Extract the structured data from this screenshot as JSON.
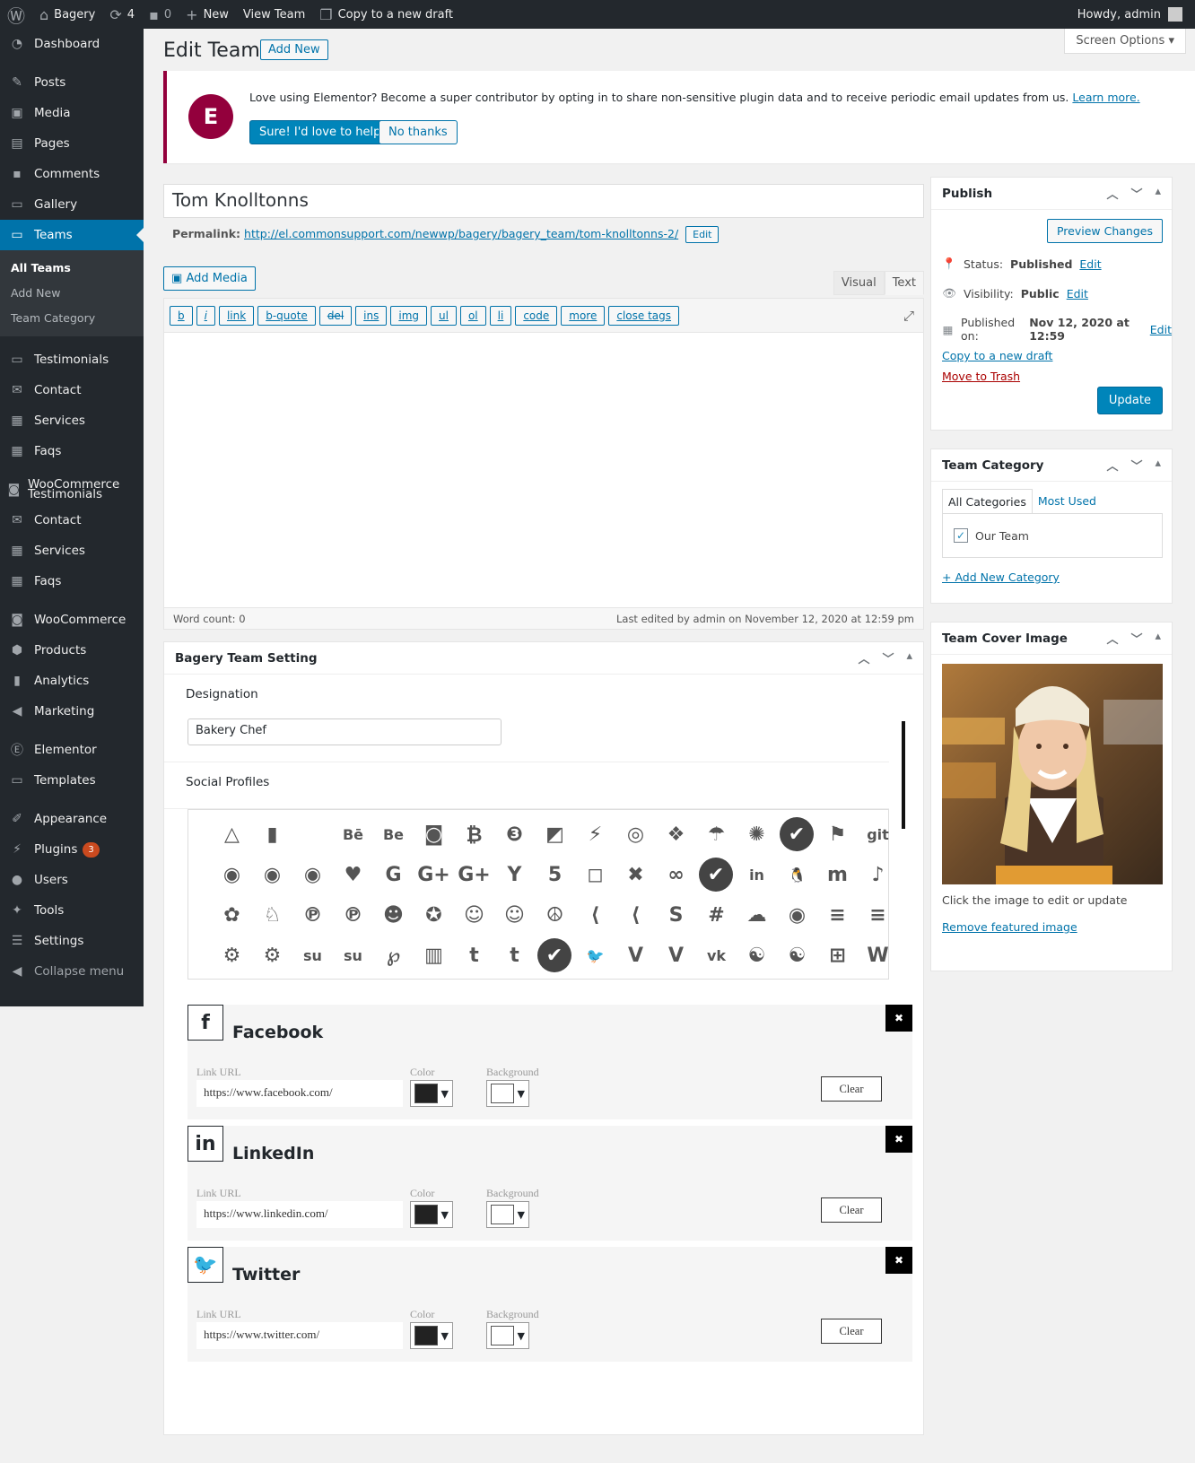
{
  "adminbar": {
    "site_name": "Bagery",
    "updates_count": "4",
    "comments_count": "0",
    "new_label": "New",
    "view_label": "View Team",
    "copy_label": "Copy to a new draft",
    "howdy": "Howdy, admin"
  },
  "sidebar": {
    "items": [
      {
        "label": "Dashboard",
        "icon": "dashboard-icon"
      },
      {
        "label": "Posts",
        "icon": "pin-icon"
      },
      {
        "label": "Media",
        "icon": "media-icon"
      },
      {
        "label": "Pages",
        "icon": "pages-icon"
      },
      {
        "label": "Comments",
        "icon": "comment-icon"
      },
      {
        "label": "Gallery",
        "icon": "folder-icon"
      },
      {
        "label": "Teams",
        "icon": "folder-icon"
      },
      {
        "label": "Testimonials",
        "icon": "folder-icon"
      },
      {
        "label": "Contact",
        "icon": "mail-icon"
      },
      {
        "label": "Services",
        "icon": "briefcase-icon"
      },
      {
        "label": "Faqs",
        "icon": "briefcase-icon"
      },
      {
        "label": "WooCommerce Testimonials",
        "icon": "woo-icon"
      },
      {
        "label": "Contact",
        "icon": "mail-icon"
      },
      {
        "label": "Services",
        "icon": "briefcase-icon"
      },
      {
        "label": "Faqs",
        "icon": "briefcase-icon"
      },
      {
        "label": "WooCommerce",
        "icon": "woo-icon"
      },
      {
        "label": "Products",
        "icon": "box-icon"
      },
      {
        "label": "Analytics",
        "icon": "chart-icon"
      },
      {
        "label": "Marketing",
        "icon": "megaphone-icon"
      },
      {
        "label": "Elementor",
        "icon": "elementor-icon"
      },
      {
        "label": "Templates",
        "icon": "folder-icon"
      },
      {
        "label": "Appearance",
        "icon": "brush-icon"
      },
      {
        "label": "Plugins",
        "icon": "plug-icon"
      },
      {
        "label": "Users",
        "icon": "user-icon"
      },
      {
        "label": "Tools",
        "icon": "wrench-icon"
      },
      {
        "label": "Settings",
        "icon": "settings-icon"
      },
      {
        "label": "Collapse menu",
        "icon": "collapse-icon"
      }
    ],
    "sub": [
      "All Teams",
      "Add New",
      "Team Category"
    ],
    "plugins_badge": "3"
  },
  "page": {
    "title": "Edit Team",
    "add_new": "Add New",
    "screen_options": "Screen Options"
  },
  "notice": {
    "text": "Love using Elementor? Become a super contributor by opting in to share non-sensitive plugin data and to receive periodic email updates from us.",
    "learn_more": "Learn more.",
    "yes_btn": "Sure! I'd love to help",
    "no_btn": "No thanks"
  },
  "post": {
    "title": "Tom Knolltonns",
    "permalink_label": "Permalink:",
    "permalink_url": "http://el.commonsupport.com/newwp/bagery/bagery_team/tom-knolltonns-2/",
    "edit_btn": "Edit",
    "add_media": "Add Media",
    "tab_visual": "Visual",
    "tab_text": "Text",
    "quicktags": [
      "b",
      "i",
      "link",
      "b-quote",
      "del",
      "ins",
      "img",
      "ul",
      "ol",
      "li",
      "code",
      "more",
      "close tags"
    ],
    "word_count": "Word count: 0",
    "last_edited": "Last edited by admin on November 12, 2020 at 12:59 pm"
  },
  "team_setting": {
    "title": "Bagery Team Setting",
    "designation_label": "Designation",
    "designation_value": "Bakery Chef",
    "social_label": "Social Profiles",
    "icons": [
      "△",
      "▮",
      "",
      "Bē",
      "Be",
      "◙",
      "₿",
      "❸",
      "◩",
      "⚡",
      "◎",
      "❖",
      "☂",
      "✺",
      "✔",
      "⚑",
      "git",
      "◉",
      "◉",
      "◉",
      "♥",
      "G",
      "G+",
      "G+",
      "Y",
      "5",
      "◻",
      "✖",
      "∞",
      "✔",
      "in",
      "🐧",
      "m",
      "♪",
      "✿",
      "♘",
      "℗",
      "℗",
      "☻",
      "✪",
      "☺",
      "☺",
      "☮",
      "⟨",
      "⟨",
      "S",
      "#",
      "☁",
      "◉",
      "≡",
      "≡",
      "⚙",
      "⚙",
      "su",
      "su",
      "℘",
      "▥",
      "t",
      "t",
      "✔",
      "🐦",
      "V",
      "V",
      "vk",
      "☯",
      "☯",
      "⊞",
      "W"
    ],
    "selected": [
      14,
      29,
      59
    ],
    "profiles": [
      {
        "icon": "f",
        "name": "Facebook",
        "url": "https://www.facebook.com/",
        "icon_name": "facebook-icon"
      },
      {
        "icon": "in",
        "name": "LinkedIn",
        "url": "https://www.linkedin.com/",
        "icon_name": "linkedin-icon"
      },
      {
        "icon": "🐦",
        "name": "Twitter",
        "url": "https://www.twitter.com/",
        "icon_name": "twitter-icon"
      }
    ],
    "link_url_label": "Link URL",
    "color_label": "Color",
    "background_label": "Background",
    "clear_label": "Clear",
    "swatch_dark": "#222222",
    "swatch_light": "#ffffff"
  },
  "publish": {
    "title": "Publish",
    "preview": "Preview Changes",
    "status_label": "Status:",
    "status_value": "Published",
    "visibility_label": "Visibility:",
    "visibility_value": "Public",
    "published_label": "Published on:",
    "published_value": "Nov 12, 2020 at 12:59",
    "edit": "Edit",
    "copy_draft": "Copy to a new draft",
    "trash": "Move to Trash",
    "update": "Update"
  },
  "team_category": {
    "title": "Team Category",
    "tab_all": "All Categories",
    "tab_most": "Most Used",
    "item": "Our Team",
    "add_new": "+ Add New Category"
  },
  "cover": {
    "title": "Team Cover Image",
    "hint": "Click the image to edit or update",
    "remove": "Remove featured image"
  }
}
